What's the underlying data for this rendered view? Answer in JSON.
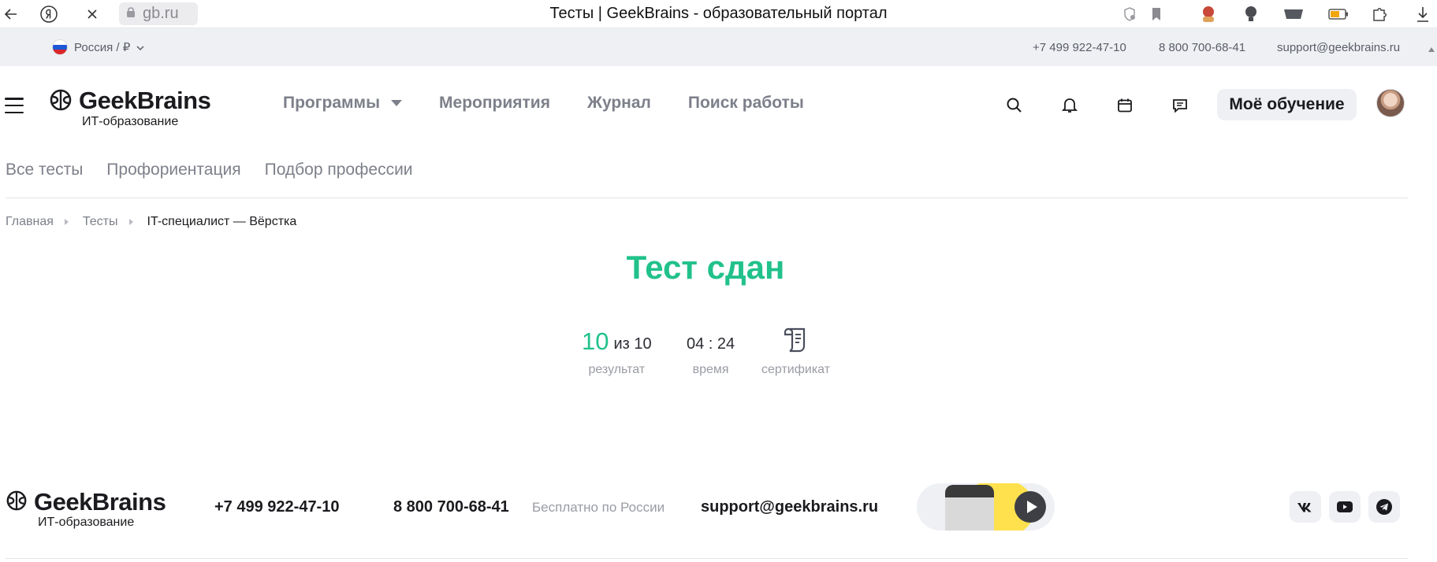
{
  "browser": {
    "url": "gb.ru",
    "tab_title": "Тесты | GeekBrains - образовательный портал"
  },
  "utility": {
    "region": "Россия / ₽",
    "phone_moscow": "+7 499 922-47-10",
    "phone_free": "8 800 700-68-41",
    "email": "support@geekbrains.ru"
  },
  "header": {
    "logo_name": "GeekBrains",
    "logo_sub": "ИТ-образование",
    "nav": [
      "Программы",
      "Мероприятия",
      "Журнал",
      "Поиск работы"
    ],
    "my_learning": "Моё обучение"
  },
  "subnav": [
    "Все тесты",
    "Профориентация",
    "Подбор профессии"
  ],
  "breadcrumb": {
    "home": "Главная",
    "tests": "Тесты",
    "current": "IT-специалист — Вёрстка"
  },
  "result": {
    "title": "Тест сдан",
    "score": "10",
    "score_total": "из 10",
    "score_label": "результат",
    "time": "04 : 24",
    "time_label": "время",
    "certificate_label": "сертификат"
  },
  "footer": {
    "logo_name": "GeekBrains",
    "logo_sub": "ИТ-образование",
    "phone_moscow": "+7 499 922-47-10",
    "phone_free": "8 800 700-68-41",
    "phone_free_note": "Бесплатно по России",
    "email": "support@geekbrains.ru"
  },
  "colors": {
    "accent_green": "#21c18a",
    "muted_text": "#7d808a",
    "utility_bg": "#eef0f4"
  }
}
